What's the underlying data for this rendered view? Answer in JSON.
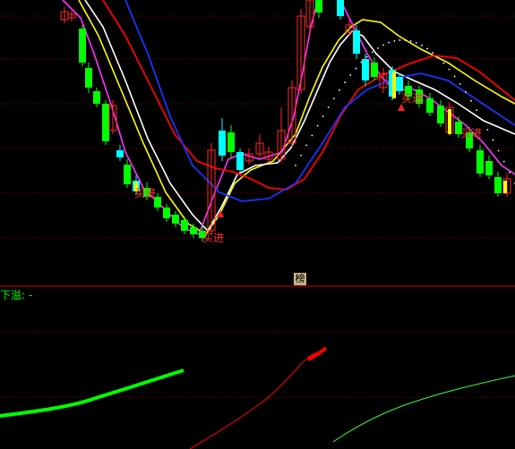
{
  "chart_data": {
    "type": "candlestick",
    "upper_signals": [
      {
        "label": "买进"
      },
      {
        "label": "买进"
      },
      {
        "label": "买进"
      },
      {
        "label": "买进"
      }
    ],
    "panel_tag": "榜",
    "lower_panel": {
      "label": "下溢: -"
    }
  },
  "colors": {
    "up": "#ff2a2a",
    "down_body": "#00ff00",
    "doji": "#00ffff",
    "ma_white": "#ffffff",
    "ma_yellow": "#ffff00",
    "ma_magenta": "#ff33ff",
    "ma_red": "#ff0000",
    "ma_blue": "#1a33ff",
    "grid": "#8b0000",
    "signal_text": "#ff3030"
  }
}
